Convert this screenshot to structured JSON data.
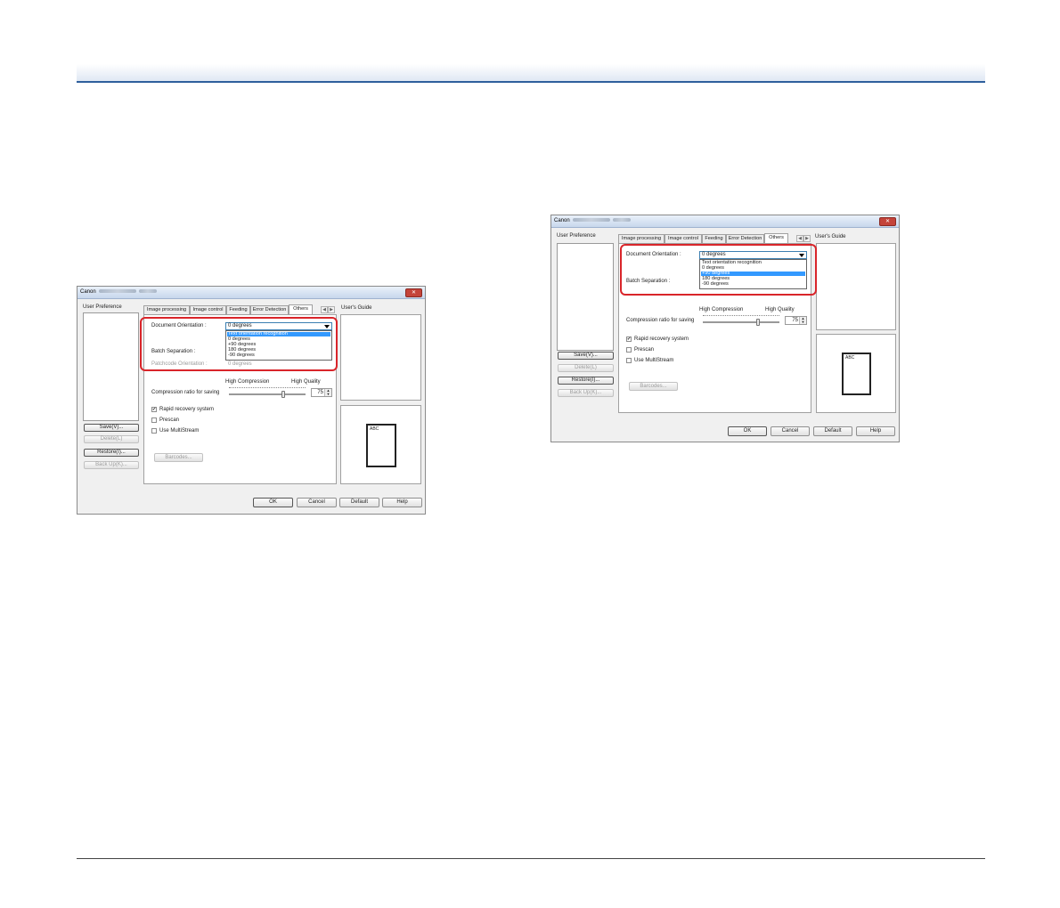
{
  "dialog_left": {
    "title": "Canon",
    "user_preference_label": "User Preference",
    "users_guide_label": "User's Guide",
    "tabs": [
      "Image processing",
      "Image control",
      "Feeding",
      "Error Detection",
      "Others"
    ],
    "document_orientation_label": "Document Orientation :",
    "document_orientation_value": "0 degrees",
    "dropdown_options": [
      "Text orientation recognition",
      "0 degrees",
      "+90 degrees",
      "180 degrees",
      "-90 degrees"
    ],
    "dropdown_selected_index": 0,
    "batch_separation_label": "Batch Separation :",
    "patchcode_orientation_label": "Patchcode Orientation :",
    "patchcode_orientation_value": "0 degrees",
    "high_compression_label": "High Compression",
    "high_quality_label": "High Quality",
    "compression_label": "Compression ratio for saving",
    "compression_value": "75",
    "rapid_recovery_label": "Rapid recovery system",
    "rapid_recovery_checked": true,
    "prescan_label": "Prescan",
    "multistream_label": "Use MultiStream",
    "barcodes_button": "Barcodes...",
    "save_button": "Save(V)...",
    "delete_button": "Delete(L)",
    "restore_button": "Restore(I)...",
    "backup_button": "Back Up(K)...",
    "ok_button": "OK",
    "cancel_button": "Cancel",
    "default_button": "Default",
    "help_button": "Help",
    "page_preview_text": "ABC"
  },
  "dialog_right": {
    "title": "Canon",
    "user_preference_label": "User Preference",
    "users_guide_label": "User's Guide",
    "tabs": [
      "Image processing",
      "Image control",
      "Feeding",
      "Error Detection",
      "Others"
    ],
    "document_orientation_label": "Document Orientation :",
    "document_orientation_value": "0 degrees",
    "dropdown_options": [
      "Text orientation recognition",
      "0 degrees",
      "+90 degrees",
      "180 degrees",
      "-90 degrees"
    ],
    "dropdown_selected_index": 2,
    "batch_separation_label": "Batch Separation :",
    "high_compression_label": "High Compression",
    "high_quality_label": "High Quality",
    "compression_label": "Compression ratio for saving",
    "compression_value": "75",
    "rapid_recovery_label": "Rapid recovery system",
    "rapid_recovery_checked": true,
    "prescan_label": "Prescan",
    "multistream_label": "Use MultiStream",
    "barcodes_button": "Barcodes...",
    "save_button": "Save(V)...",
    "delete_button": "Delete(L)",
    "restore_button": "Restore(I)...",
    "backup_button": "Back Up(K)...",
    "ok_button": "OK",
    "cancel_button": "Cancel",
    "default_button": "Default",
    "help_button": "Help",
    "page_preview_text": "ABC"
  },
  "colors": {
    "header_rule": "#2f5f9c",
    "highlight_box": "#d9252a",
    "selection": "#3399ff"
  }
}
